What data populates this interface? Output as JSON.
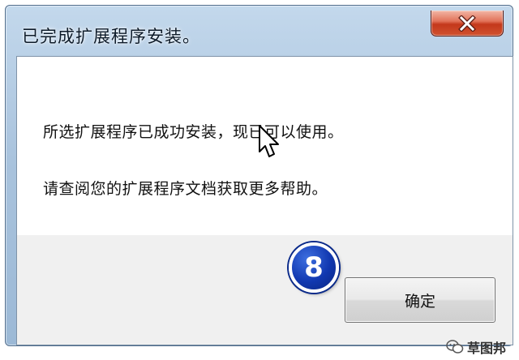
{
  "dialog": {
    "title": "已完成扩展程序安装。",
    "message_line1": "所选扩展程序已成功安装，现已可以使用。",
    "message_line2": "请查阅您的扩展程序文档获取更多帮助。",
    "ok_label": "确定",
    "close_icon": "close-icon"
  },
  "annotation": {
    "step_number": "8"
  },
  "watermark": {
    "text": "草图邦",
    "icon": "wechat-icon"
  },
  "colors": {
    "title_bar": "#a9c3dd",
    "close_button": "#c4381b",
    "step_badge": "#1138b0"
  }
}
